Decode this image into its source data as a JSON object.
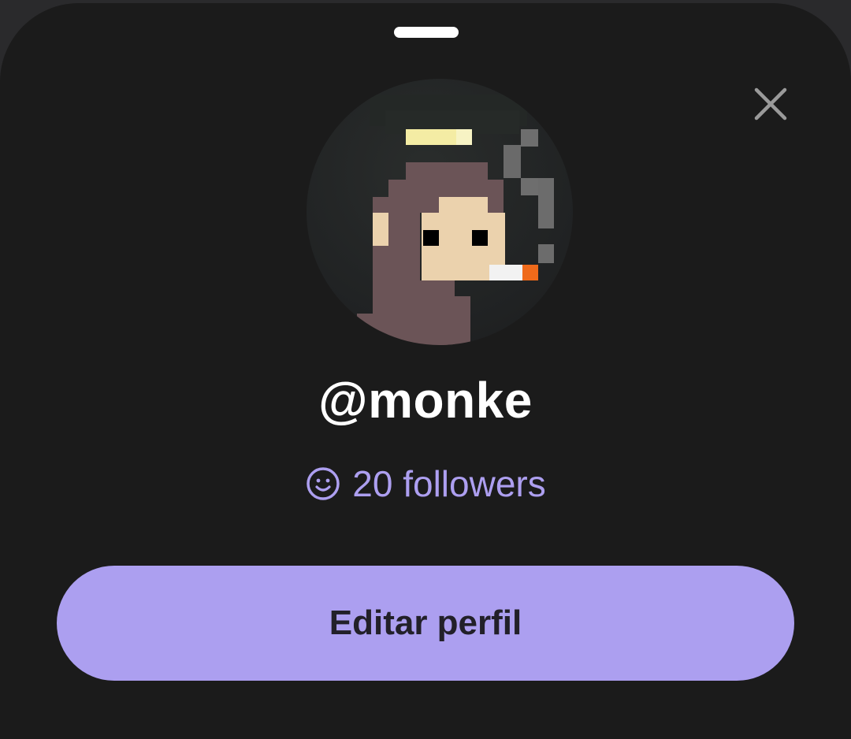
{
  "profile": {
    "username": "@monke",
    "followers_label": "20 followers"
  },
  "actions": {
    "edit_label": "Editar perfil"
  },
  "icons": {
    "close": "close-icon",
    "followers": "smiley-icon"
  },
  "colors": {
    "sheet_background": "#1b1b1b",
    "accent": "#ac9ff0",
    "followers_text": "#ad9ff0",
    "username_text": "#ffffff"
  }
}
